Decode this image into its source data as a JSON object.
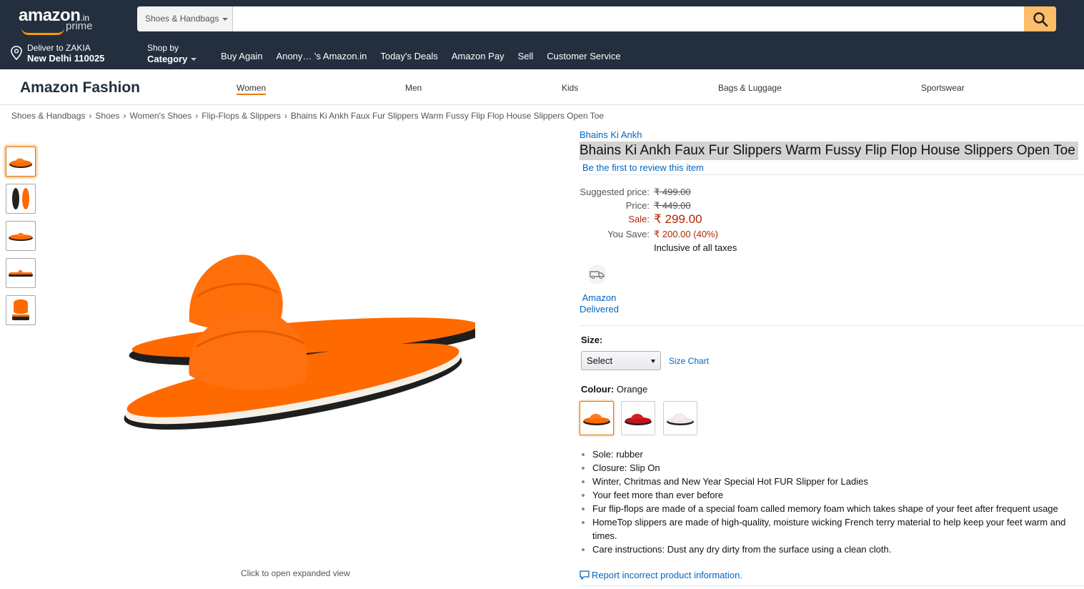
{
  "header": {
    "logo_text": "amazon",
    "logo_tld": ".in",
    "logo_sub": "prime",
    "search": {
      "category": "Shoes & Handbags",
      "placeholder": "",
      "button_icon": "search-icon"
    },
    "deliver": {
      "line1": "Deliver to ZAKIA",
      "line2": "New Delhi 110025",
      "icon": "location-pin-icon"
    },
    "shop_by": {
      "line1": "Shop by",
      "line2": "Category"
    },
    "nav_links": [
      "Buy Again",
      "Anony…",
      "'s Amazon.in",
      "Today's Deals",
      "Amazon Pay",
      "Sell",
      "Customer Service"
    ]
  },
  "fashion_bar": {
    "title": "Amazon Fashion",
    "items": [
      "Women",
      "Men",
      "Kids",
      "Bags & Luggage",
      "Sportswear"
    ],
    "active": "Women"
  },
  "breadcrumb": [
    "Shoes & Handbags",
    "Shoes",
    "Women's Shoes",
    "Flip-Flops & Slippers",
    "Bhains Ki Ankh Faux Fur Slippers Warm Fussy Flip Flop House Slippers Open Toe"
  ],
  "gallery": {
    "thumbnail_count": 5,
    "selected_index": 0,
    "click_hint": "Click to open expanded view"
  },
  "product": {
    "brand": "Bhains Ki Ankh",
    "title": "Bhains Ki Ankh Faux Fur Slippers Warm Fussy Flip Flop House Slippers Open Toe",
    "review_link": "Be the first to review this item",
    "prices": {
      "suggested_label": "Suggested price:",
      "suggested_value": "₹ 499.00",
      "price_label": "Price:",
      "price_value": "₹ 449.00",
      "sale_label": "Sale:",
      "sale_value": "₹ 299.00",
      "save_label": "You Save:",
      "save_value": "₹ 200.00 (40%)",
      "tax_note": "Inclusive of all taxes"
    },
    "delivered": "Amazon Delivered",
    "size": {
      "label": "Size:",
      "selected": "Select",
      "chart_link": "Size Chart"
    },
    "colour": {
      "label": "Colour:",
      "value": "Orange",
      "swatches": [
        "orange",
        "red",
        "white"
      ]
    },
    "bullets": [
      "Sole: rubber",
      "Closure: Slip On",
      "Winter, Chritmas and New Year Special Hot FUR Slipper for Ladies",
      "Your feet more than ever before",
      "Fur flip-flops are made of a special foam called memory foam which takes shape of your feet after frequent usage",
      "HomeTop slippers are made of high-quality, moisture wicking French terry material to help keep your feet warm and times.",
      "Care instructions: Dust any dry dirty from the surface using a clean cloth."
    ],
    "report_link": "Report incorrect product information."
  },
  "colors": {
    "header_bg": "#232f3e",
    "search_button": "#febd69",
    "link": "#0066c0",
    "price_red": "#b12704",
    "accent_orange": "#e47911",
    "slipper_orange": "#ff6a00"
  }
}
